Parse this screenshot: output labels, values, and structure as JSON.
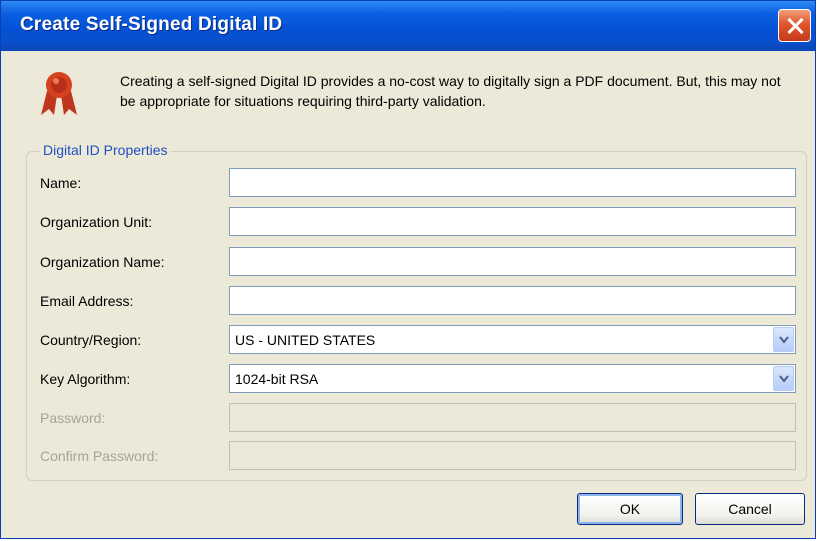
{
  "window": {
    "title": "Create Self-Signed Digital ID"
  },
  "intro": "Creating a self-signed Digital ID provides a no-cost way to digitally sign a PDF document. But, this may not be appropriate for situations requiring third-party validation.",
  "group": {
    "legend": "Digital ID Properties",
    "labels": {
      "name": "Name:",
      "org_unit": "Organization Unit:",
      "org_name": "Organization Name:",
      "email": "Email Address:",
      "country": "Country/Region:",
      "key_algorithm": "Key Algorithm:",
      "password": "Password:",
      "confirm_password": "Confirm Password:"
    },
    "values": {
      "name": "",
      "org_unit": "",
      "org_name": "",
      "email": "",
      "country": "US - UNITED STATES",
      "key_algorithm": "1024-bit RSA"
    }
  },
  "buttons": {
    "ok": "OK",
    "cancel": "Cancel"
  }
}
